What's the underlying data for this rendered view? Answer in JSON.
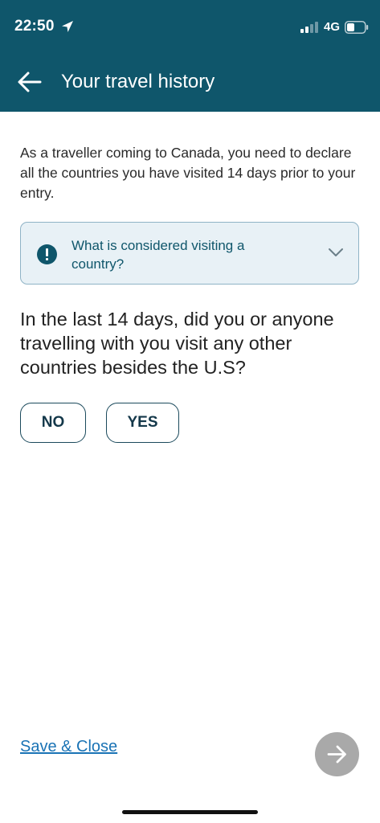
{
  "status_bar": {
    "time": "22:50",
    "network": "4G",
    "icons": [
      "location-arrow-icon",
      "signal-icon",
      "battery-icon"
    ]
  },
  "header": {
    "title": "Your travel history",
    "back_icon": "arrow-left-icon",
    "background_color": "#0f566b"
  },
  "intro_text": "As a traveller coming to Canada, you need to declare all the countries you have visited 14 days prior to your entry.",
  "info_box": {
    "icon": "exclamation-icon",
    "text": "What is considered visiting a country?",
    "expand_icon": "chevron-down-icon"
  },
  "question": "In the last 14 days, did you or anyone travelling with you visit any other countries besides the U.S?",
  "answers": {
    "no_label": "NO",
    "yes_label": "YES"
  },
  "footer": {
    "save_close_label": "Save & Close",
    "next_icon": "arrow-right-icon",
    "link_color": "#1a73b5"
  }
}
